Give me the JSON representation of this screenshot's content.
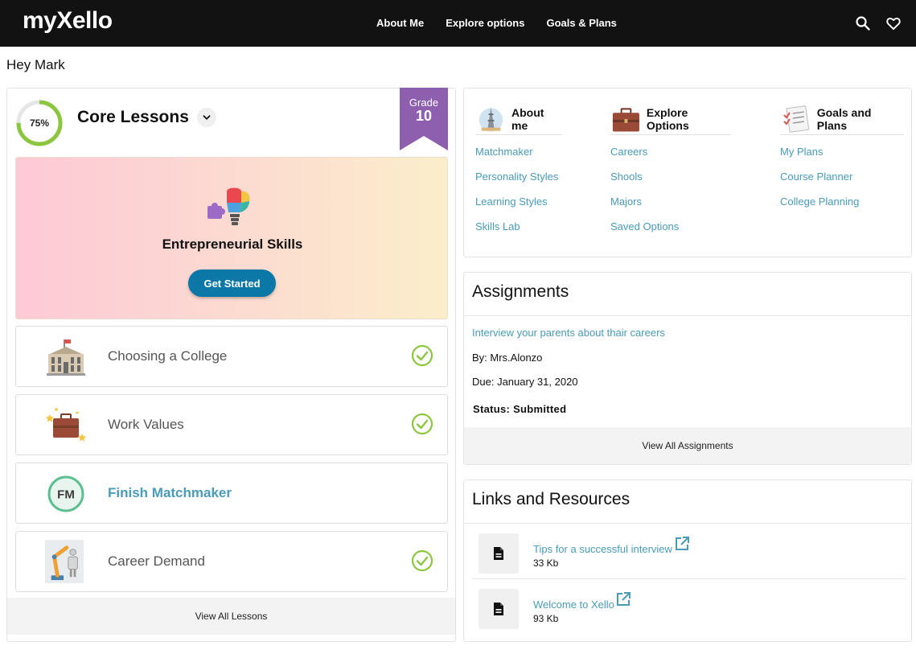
{
  "app": {
    "logo": "myXello",
    "nav": [
      "About Me",
      "Explore options",
      "Goals & Plans"
    ],
    "icons": [
      "search-icon",
      "heart-icon"
    ]
  },
  "greeting": "Hey Mark",
  "core_lessons": {
    "progress_label": "75%",
    "progress_value": 0.75,
    "title": "Core Lessons",
    "grade_label": "Grade",
    "grade_value": "10",
    "featured": {
      "title": "Entrepreneurial Skills",
      "button": "Get Started"
    },
    "lessons": [
      {
        "title": "Choosing a College",
        "completed": true,
        "icon": "college-building-icon"
      },
      {
        "title": "Work Values",
        "completed": true,
        "icon": "briefcase-stars-icon"
      },
      {
        "title": "Finish Matchmaker",
        "completed": false,
        "icon": "fm-badge-icon",
        "badge": "FM"
      },
      {
        "title": "Career Demand",
        "completed": true,
        "icon": "robot-arm-icon"
      }
    ],
    "view_all": "View All Lessons"
  },
  "quick_nav": {
    "columns": [
      {
        "title": "About me",
        "icon": "tower-globe-icon",
        "links": [
          "Matchmaker",
          "Personality Styles",
          "Learning Styles",
          "Skills Lab"
        ]
      },
      {
        "title": "Explore Options",
        "icon": "briefcase-icon",
        "links": [
          "Careers",
          "Shools",
          "Majors",
          "Saved Options"
        ]
      },
      {
        "title": "Goals and Plans",
        "icon": "checklist-icon",
        "links": [
          "My Plans",
          "Course Planner",
          "College Planning"
        ]
      }
    ]
  },
  "assignments": {
    "title": "Assignments",
    "item": {
      "title": "Interview your parents about thair careers",
      "by": "By: Mrs.Alonzo",
      "due": "Due: January 31, 2020",
      "status": "Status: Submitted"
    },
    "view_all": "View All Assignments"
  },
  "links": {
    "title": "Links and Resources",
    "items": [
      {
        "name": "Tips for a successful interview",
        "size": "33 Kb"
      },
      {
        "name": "Welcome to Xello",
        "size": "93 Kb"
      }
    ]
  },
  "colors": {
    "accent_link": "#4a9bb8",
    "button_blue": "#0b78a8",
    "check_green": "#8cc63f",
    "grade_purple": "#8e5fae",
    "topbar": "#121212"
  }
}
